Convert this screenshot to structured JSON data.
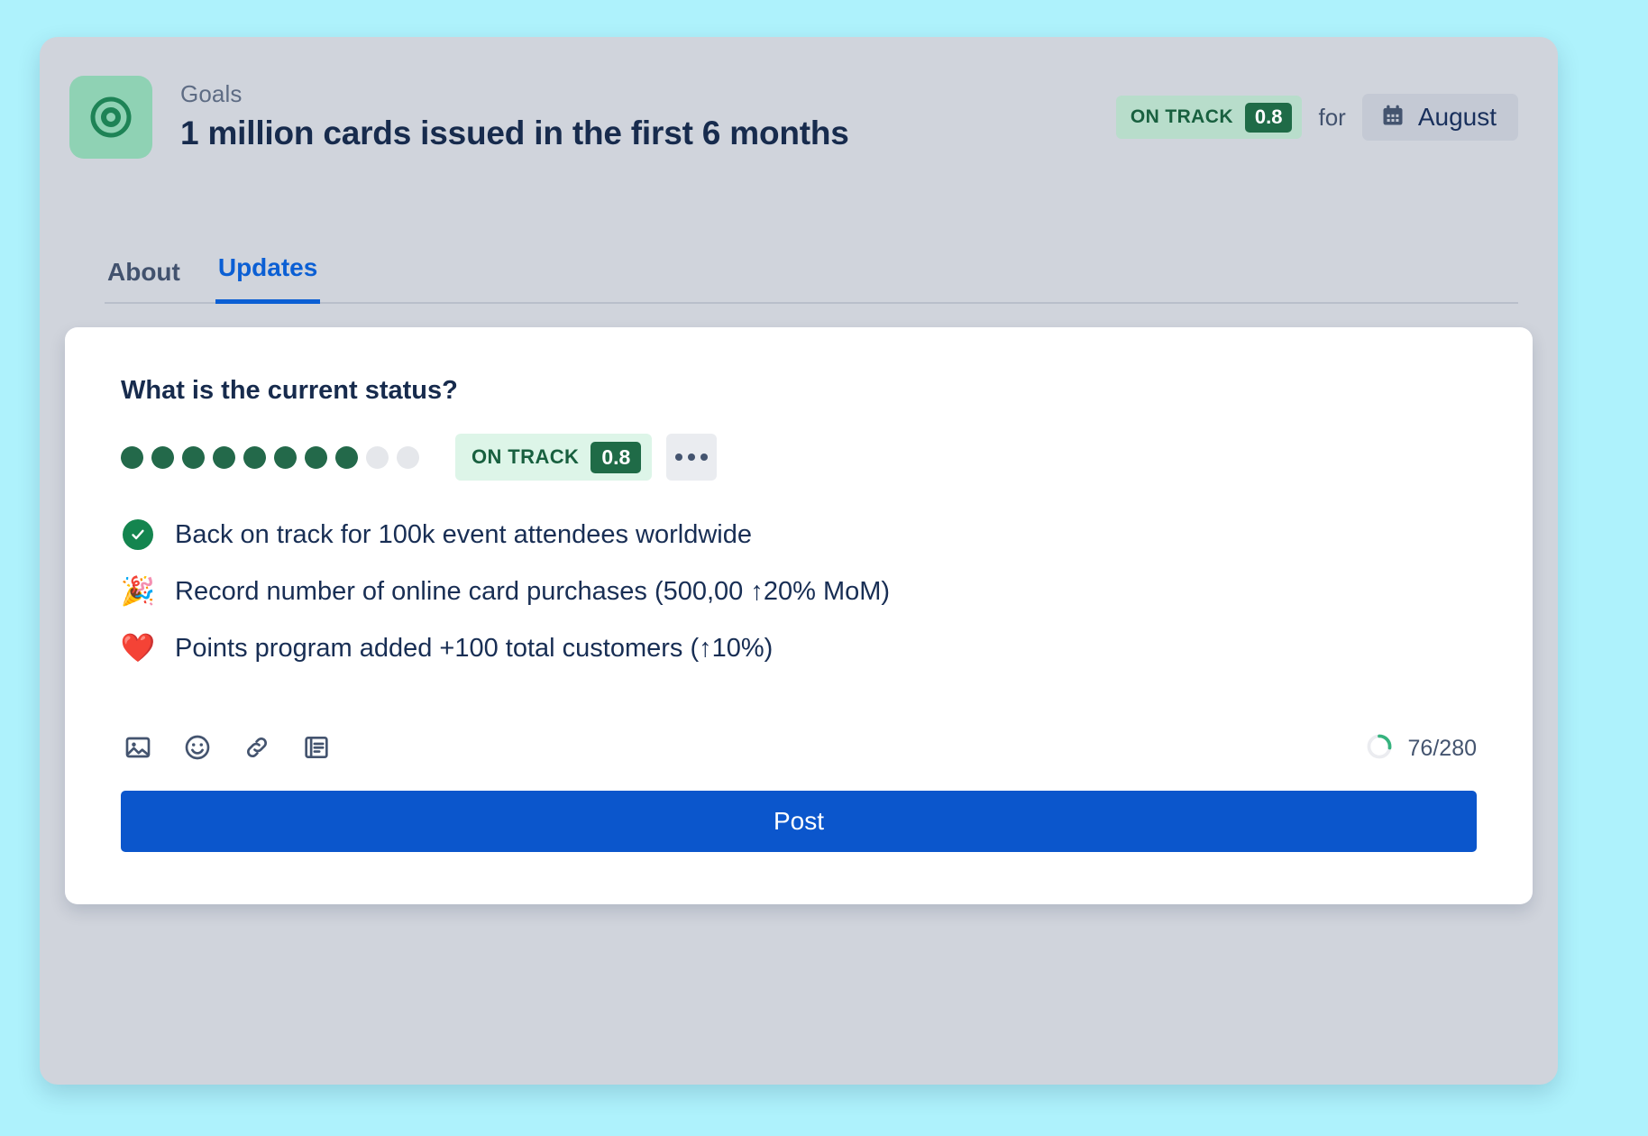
{
  "colors": {
    "page_background": "#AEF2FC",
    "panel_background": "#D0D4DC",
    "card_background": "#FFFFFF",
    "accent_blue": "#0B5FD4",
    "post_button_blue": "#0B56CC",
    "status_green_dark": "#1F6B47",
    "status_green_dot": "#23694A",
    "status_pill_header": "#B8DDCB",
    "status_pill_inline": "#DDF5E8",
    "avatar_green": "#8FD2B4",
    "text_primary": "#172B4D",
    "text_muted": "#5E6C84"
  },
  "header": {
    "avatar_icon": "target-icon",
    "eyebrow": "Goals",
    "title": "1 million cards issued in the first 6 months",
    "status": {
      "label": "ON TRACK",
      "score": "0.8"
    },
    "for_word": "for",
    "month_chip": {
      "icon": "calendar-icon",
      "label": "August"
    }
  },
  "tabs": [
    {
      "label": "About",
      "active": false
    },
    {
      "label": "Updates",
      "active": true
    }
  ],
  "composer": {
    "question": "What is the current status?",
    "progress_dots": {
      "total": 10,
      "filled": 8
    },
    "status": {
      "label": "ON TRACK",
      "score": "0.8"
    },
    "more_button": "more-options-icon",
    "bullets": [
      {
        "icon": "check-circle-icon",
        "emoji": "",
        "text": "Back on track for 100k event attendees worldwide"
      },
      {
        "icon": "party-popper-emoji",
        "emoji": "🎉",
        "text": "Record number of online card purchases (500,00 ↑20% MoM)"
      },
      {
        "icon": "red-heart-emoji",
        "emoji": "❤️",
        "text": "Points program added +100 total customers (↑10%)"
      }
    ],
    "toolbar_icons": [
      "image-icon",
      "emoji-icon",
      "link-icon",
      "document-icon"
    ],
    "character_counter": {
      "text": "76/280",
      "current": 76,
      "max": 280,
      "ring_icon": "progress-ring-icon"
    },
    "post_label": "Post"
  }
}
